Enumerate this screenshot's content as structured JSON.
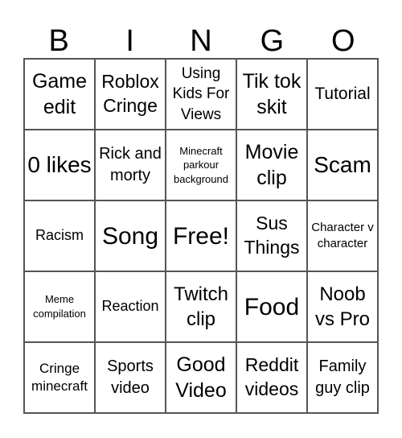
{
  "header": [
    "B",
    "I",
    "N",
    "G",
    "O"
  ],
  "cells": [
    {
      "text": "Game edit",
      "size": "s25"
    },
    {
      "text": "Roblox Cringe",
      "size": "s23"
    },
    {
      "text": "Using Kids For Views",
      "size": "s19"
    },
    {
      "text": "Tik tok skit",
      "size": "s25"
    },
    {
      "text": "Tutorial",
      "size": "s21"
    },
    {
      "text": "0 likes",
      "size": "s28"
    },
    {
      "text": "Rick and morty",
      "size": "s20"
    },
    {
      "text": "Minecraft parkour background",
      "size": "s13"
    },
    {
      "text": "Movie clip",
      "size": "s25"
    },
    {
      "text": "Scam",
      "size": "s28"
    },
    {
      "text": "Racism",
      "size": "s18"
    },
    {
      "text": "Song",
      "size": "s30"
    },
    {
      "text": "Free!",
      "size": "s30"
    },
    {
      "text": "Sus Things",
      "size": "s23"
    },
    {
      "text": "Character v character",
      "size": "s15"
    },
    {
      "text": "Meme compilation",
      "size": "s13"
    },
    {
      "text": "Reaction",
      "size": "s18"
    },
    {
      "text": "Twitch clip",
      "size": "s24"
    },
    {
      "text": "Food",
      "size": "s30"
    },
    {
      "text": "Noob vs Pro",
      "size": "s24"
    },
    {
      "text": "Cringe minecraft",
      "size": "s17"
    },
    {
      "text": "Sports video",
      "size": "s20"
    },
    {
      "text": "Good Video",
      "size": "s25"
    },
    {
      "text": "Reddit videos",
      "size": "s23"
    },
    {
      "text": "Family guy clip",
      "size": "s20"
    }
  ]
}
